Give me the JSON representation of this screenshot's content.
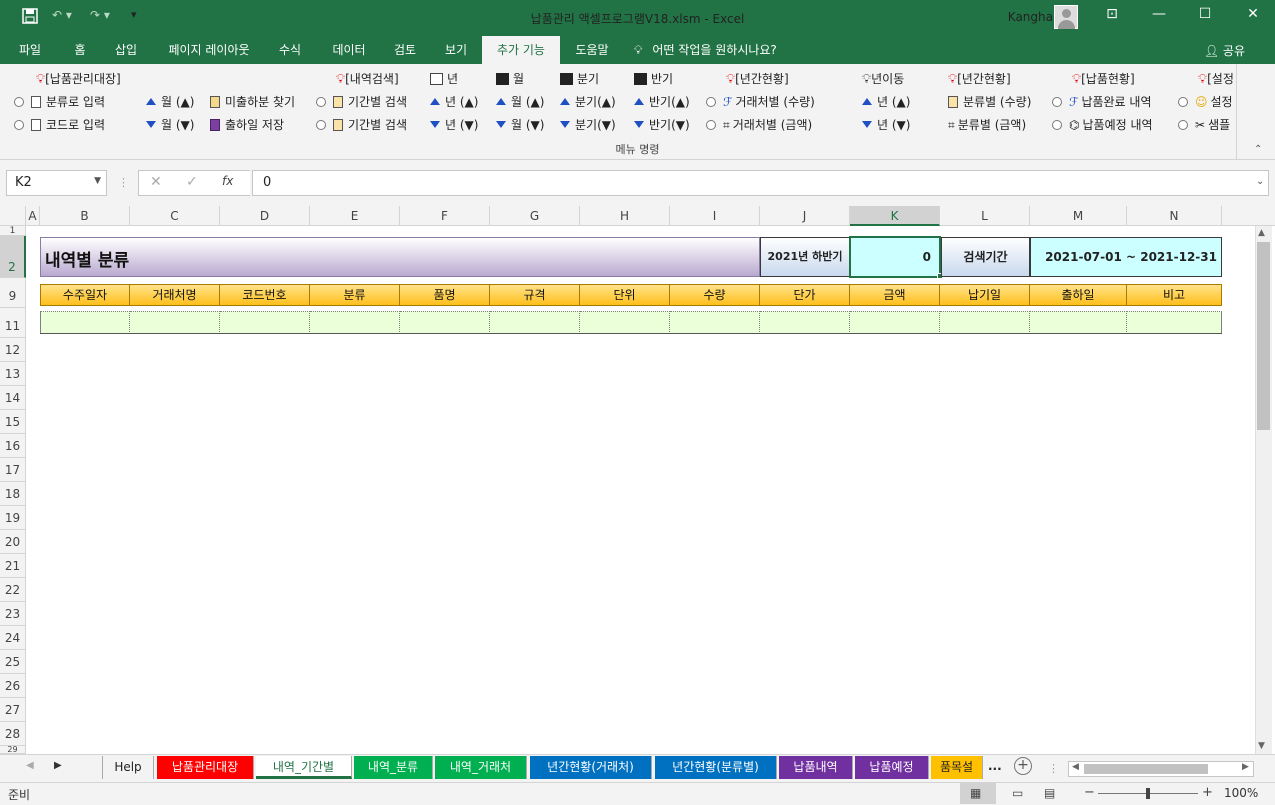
{
  "window": {
    "title": "납품관리 액셀프로그램V18.xlsm  -  Excel",
    "user": "Kangha"
  },
  "menu_tabs": [
    "파일",
    "홈",
    "삽입",
    "페이지 레이아웃",
    "수식",
    "데이터",
    "검토",
    "보기",
    "추가 기능",
    "도움말"
  ],
  "tell_me": "어떤 작업을 원하시나요?",
  "share": "공유",
  "ribbon": {
    "group_label": "메뉴 명령",
    "row1": [
      {
        "label": "[납품관리대장]",
        "icon": "lightbulb-icon"
      },
      {
        "label": "[내역검색]",
        "icon": "lightbulb-icon"
      },
      {
        "label": "년",
        "icon": "table-function-icon"
      },
      {
        "label": "월",
        "icon": "grid-icon"
      },
      {
        "label": "분기",
        "icon": "grid-icon"
      },
      {
        "label": "반기",
        "icon": "grid-icon"
      },
      {
        "label": "[년간현황]",
        "icon": "lightbulb-icon"
      },
      {
        "label": "년이동",
        "icon": "lightbulb-outline-icon"
      },
      {
        "label": "[년간현황]",
        "icon": "lightbulb-icon"
      },
      {
        "label": "[납품현황]",
        "icon": "lightbulb-icon"
      },
      {
        "label": "[설정",
        "icon": "lightbulb-icon"
      }
    ],
    "row2": [
      "분류로 입력",
      "월 (▲)",
      "미출하분 찾기",
      "기간별 검색",
      "년 (▲)",
      "월 (▲)",
      "분기(▲)",
      "반기(▲)",
      "거래처별 (수량)",
      "년 (▲)",
      "분류별 (수량)",
      "납품완료 내역",
      "설정"
    ],
    "row3": [
      "코드로 입력",
      "월 (▼)",
      "출하일 저장",
      "기간별 검색",
      "년 (▼)",
      "월 (▼)",
      "분기(▼)",
      "반기(▼)",
      "거래처별 (금액)",
      "년 (▼)",
      "분류별 (금액)",
      "납품예정 내역",
      "샘플"
    ]
  },
  "formula_bar": {
    "name_box": "K2",
    "formula": "0",
    "fx": "fx"
  },
  "columns": [
    "A",
    "B",
    "C",
    "D",
    "E",
    "F",
    "G",
    "H",
    "I",
    "J",
    "K",
    "L",
    "M",
    "N"
  ],
  "rows": [
    "1",
    "2",
    "9",
    "11",
    "12",
    "13",
    "14",
    "15",
    "16",
    "17",
    "18",
    "19",
    "20",
    "21",
    "22",
    "23",
    "24",
    "25",
    "26",
    "27",
    "28",
    "29"
  ],
  "sheet": {
    "title": "내역별 분류",
    "period_label": "2021년 하반기",
    "period_value": "0",
    "search_label": "검색기간",
    "date_range": "2021-07-01  ~  2021-12-31",
    "headers": [
      "수주일자",
      "거래처명",
      "코드번호",
      "분류",
      "품명",
      "규격",
      "단위",
      "수량",
      "단가",
      "금액",
      "납기일",
      "출하일",
      "비고"
    ]
  },
  "sheet_tabs": [
    {
      "label": "Help",
      "color": "#f3f3f3"
    },
    {
      "label": "납품관리대장",
      "color": "#ff0000"
    },
    {
      "label": "내역_기간별",
      "color": "#ffffff"
    },
    {
      "label": "내역_분류",
      "color": "#00b050"
    },
    {
      "label": "내역_거래처",
      "color": "#00b050"
    },
    {
      "label": "년간현황(거래처)",
      "color": "#0070c0"
    },
    {
      "label": "년간현황(분류별)",
      "color": "#0070c0"
    },
    {
      "label": "납품내역",
      "color": "#7030a0"
    },
    {
      "label": "납품예정",
      "color": "#7030a0"
    },
    {
      "label": "품목설",
      "color": "#ffc000"
    }
  ],
  "more_tabs": "...",
  "status": {
    "ready": "준비",
    "zoom": "100%"
  }
}
